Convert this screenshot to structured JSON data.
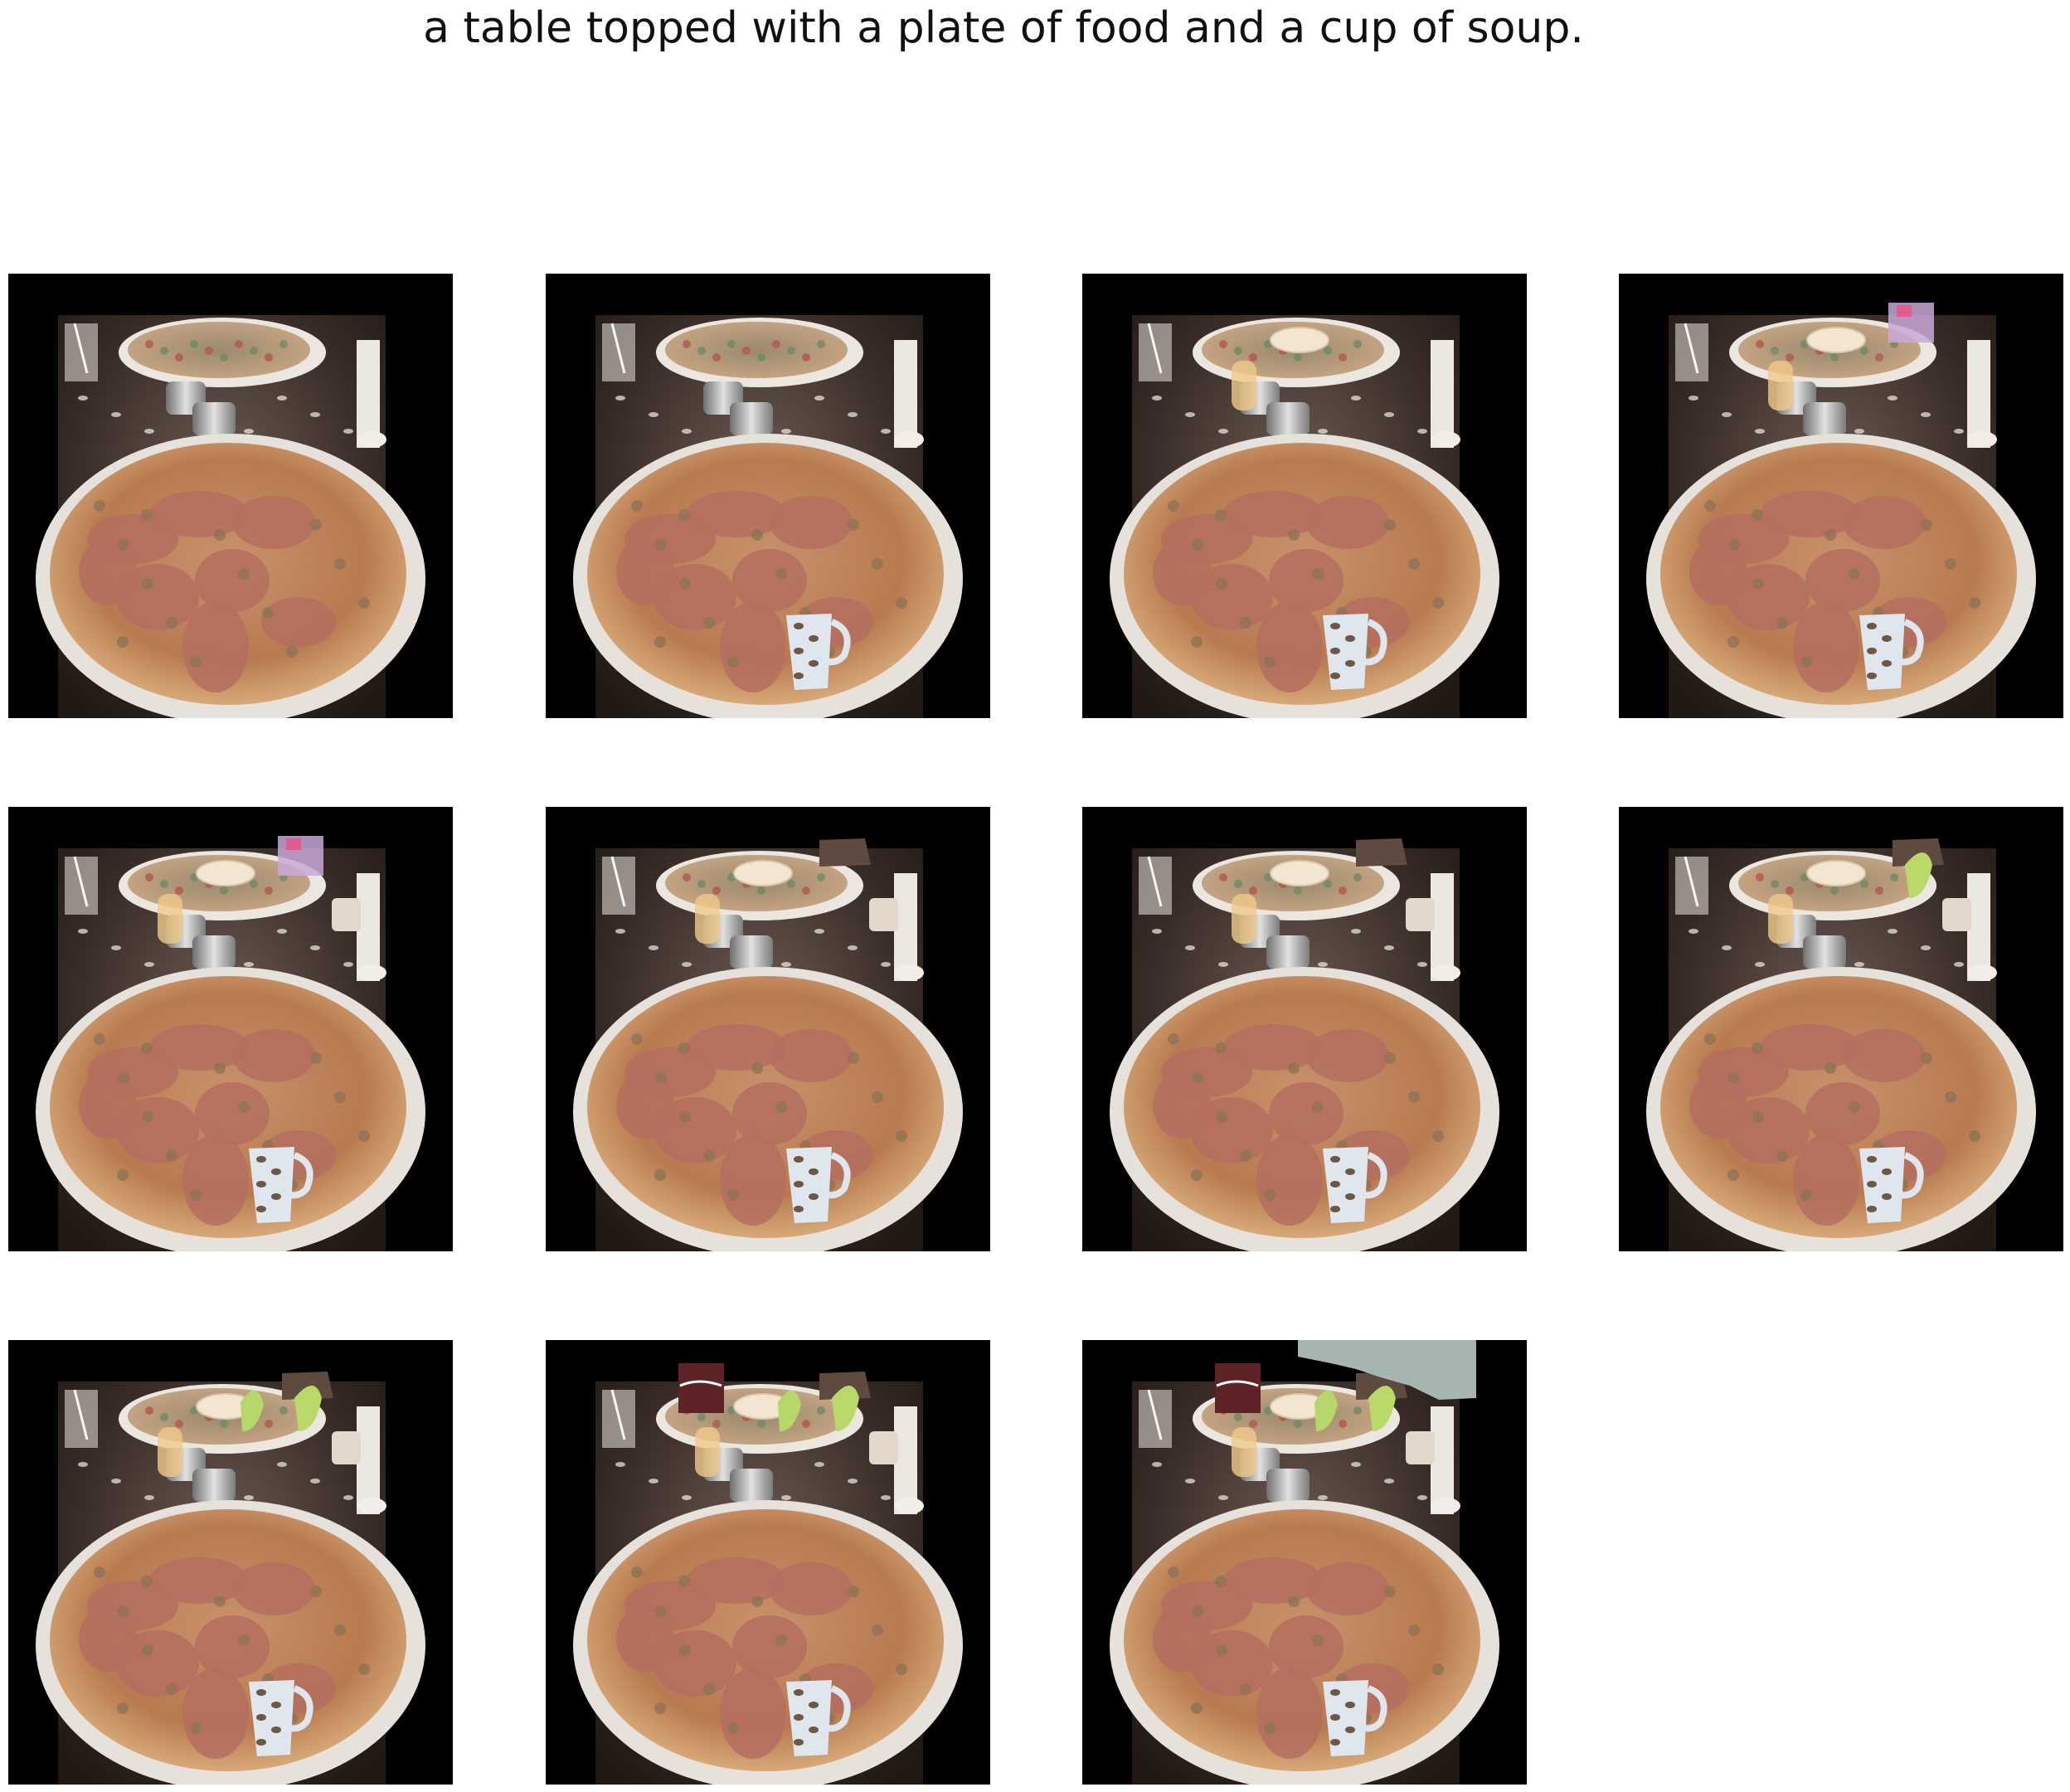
{
  "caption": "a table topped with a plate of food and a cup of soup.",
  "frames": [
    {
      "index": 1,
      "objects": []
    },
    {
      "index": 2,
      "objects": [
        "mug"
      ]
    },
    {
      "index": 3,
      "objects": [
        "mug",
        "small-plate",
        "glass"
      ]
    },
    {
      "index": 4,
      "objects": [
        "mug",
        "small-plate",
        "glass",
        "pink-box"
      ]
    },
    {
      "index": 5,
      "objects": [
        "mug",
        "small-plate",
        "glass",
        "pink-box",
        "side-mug"
      ]
    },
    {
      "index": 6,
      "objects": [
        "mug",
        "small-plate",
        "glass",
        "side-mug",
        "dark-lid"
      ]
    },
    {
      "index": 7,
      "objects": [
        "mug",
        "small-plate",
        "glass",
        "side-mug",
        "dark-lid"
      ]
    },
    {
      "index": 8,
      "objects": [
        "mug",
        "small-plate",
        "glass",
        "side-mug",
        "dark-lid",
        "green-vegetable"
      ]
    },
    {
      "index": 9,
      "objects": [
        "mug",
        "small-plate",
        "glass",
        "side-mug",
        "dark-lid",
        "green-vegetable",
        "second-green-vegetable"
      ]
    },
    {
      "index": 10,
      "objects": [
        "mug",
        "small-plate",
        "glass",
        "side-mug",
        "dark-lid",
        "green-vegetable",
        "second-green-vegetable",
        "cola-can"
      ]
    },
    {
      "index": 11,
      "objects": [
        "mug",
        "small-plate",
        "glass",
        "side-mug",
        "dark-lid",
        "green-vegetable",
        "second-green-vegetable",
        "cola-can",
        "blue-gray-patch"
      ]
    }
  ],
  "colors": {
    "background": "#ffffff",
    "tile_border": "#000000",
    "table": "#4a3a33",
    "pizza": "#c98a5e",
    "ham": "#b56f62",
    "plate": "#e9e4de",
    "mug": "#dfe6ee"
  }
}
